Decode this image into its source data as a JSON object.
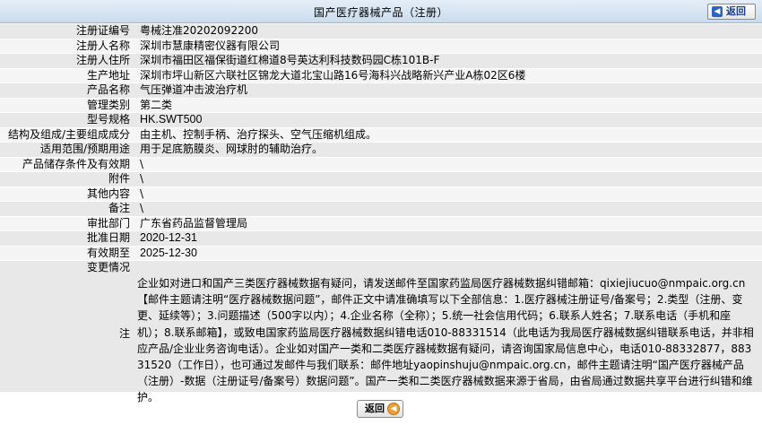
{
  "header": {
    "title": "国产医疗器械产品（注册）",
    "back_label": "返回"
  },
  "rows": [
    {
      "label": "注册证编号",
      "value": "粤械注准20202092200",
      "latin": false
    },
    {
      "label": "注册人名称",
      "value": "深圳市慧康精密仪器有限公司",
      "latin": false
    },
    {
      "label": "注册人住所",
      "value": "深圳市福田区福保街道红棉道8号英达利科技数码园C栋101B-F",
      "latin": false
    },
    {
      "label": "生产地址",
      "value": "深圳市坪山新区六联社区锦龙大道北宝山路16号海科兴战略新兴产业A栋02区6楼",
      "latin": false
    },
    {
      "label": "产品名称",
      "value": "气压弹道冲击波治疗机",
      "latin": false
    },
    {
      "label": "管理类别",
      "value": "第二类",
      "latin": false
    },
    {
      "label": "型号规格",
      "value": "HK.SWT500",
      "latin": true
    },
    {
      "label": "结构及组成/主要组成成分",
      "value": "由主机、控制手柄、治疗探头、空气压缩机组成。",
      "latin": false
    },
    {
      "label": "适用范围/预期用途",
      "value": "用于足底筋膜炎、网球肘的辅助治疗。",
      "latin": false
    },
    {
      "label": "产品储存条件及有效期",
      "value": "\\",
      "latin": false
    },
    {
      "label": "附件",
      "value": "\\",
      "latin": false
    },
    {
      "label": "其他内容",
      "value": "\\",
      "latin": false
    },
    {
      "label": "备注",
      "value": "\\",
      "latin": false
    },
    {
      "label": "审批部门",
      "value": "广东省药品监督管理局",
      "latin": false
    },
    {
      "label": "批准日期",
      "value": "2020-12-31",
      "latin": true
    },
    {
      "label": "有效期至",
      "value": "2025-12-30",
      "latin": true
    },
    {
      "label": "变更情况",
      "value": "",
      "latin": false
    }
  ],
  "note": {
    "label": "注",
    "text": "企业如对进口和国产三类医疗器械数据有疑问，请发送邮件至国家药监局医疗器械数据纠错邮箱：qixiejiucuo@nmpaic.org.cn【邮件主题请注明“医疗器械数据问题”，邮件正文中请准确填写以下全部信息：1.医疗器械注册证号/备案号；2.类型（注册、变更、延续等）；3.问题描述（500字以内）；4.企业名称（全称）；5.统一社会信用代码；6.联系人姓名；7.联系电话（手机和座机）；8.联系邮箱】，或致电国家药监局医疗器械数据纠错电话010-88331514（此电话为我局医疗器械数据纠错联系电话，并非相应产品/企业业务咨询电话）。企业如对国产一类和二类医疗器械数据有疑问，请咨询国家局信息中心，电话010-88332877，88331520（工作日），也可通过发邮件与我们联系：邮件地址yaopinshuju@nmpaic.org.cn，邮件主题请注明“国产医疗器械产品（注册）-数据（注册证号/备案号）数据问题”。国产一类和二类医疗器械数据来源于省局，由省局通过数据共享平台进行纠错和维护。"
  },
  "footer": {
    "back_label": "返回"
  }
}
